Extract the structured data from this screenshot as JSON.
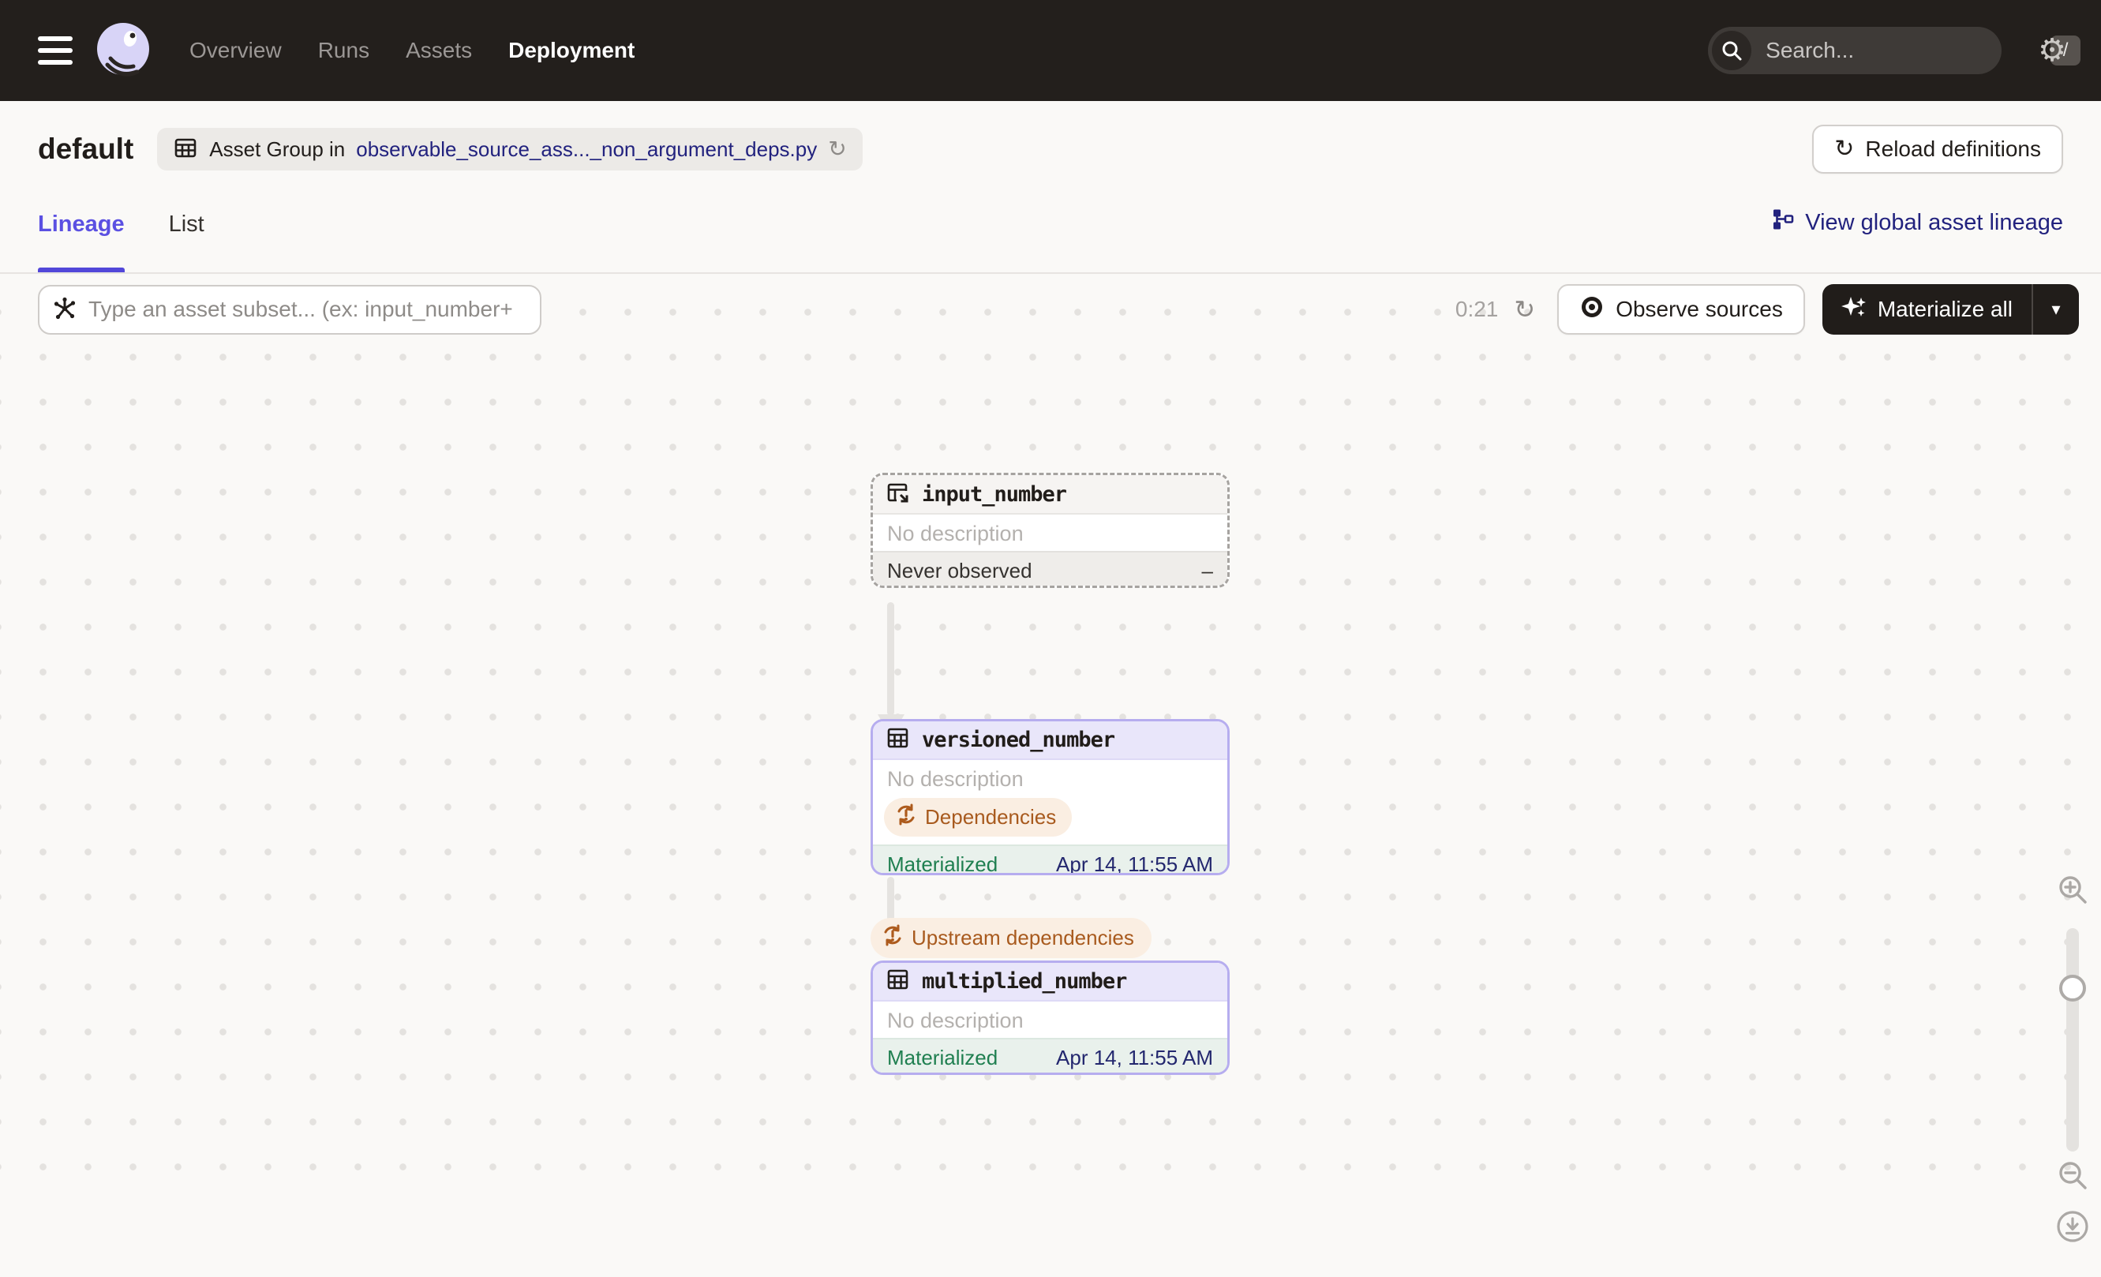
{
  "nav": {
    "items": [
      {
        "label": "Overview",
        "active": false
      },
      {
        "label": "Runs",
        "active": false
      },
      {
        "label": "Assets",
        "active": false
      },
      {
        "label": "Deployment",
        "active": true
      }
    ],
    "search": {
      "placeholder": "Search...",
      "shortcut": "/"
    }
  },
  "header": {
    "title": "default",
    "group_badge_prefix": "Asset Group in",
    "group_badge_link": "observable_source_ass..._non_argument_deps.py",
    "reload_button": "Reload definitions"
  },
  "tabs": {
    "items": [
      {
        "label": "Lineage",
        "active": true
      },
      {
        "label": "List",
        "active": false
      }
    ],
    "global_lineage_link": "View global asset lineage"
  },
  "toolbar": {
    "filter_placeholder": "Type an asset subset... (ex: input_number+",
    "timer": "0:21",
    "observe_button": "Observe sources",
    "materialize_button": "Materialize all"
  },
  "graph": {
    "nodes": [
      {
        "name": "input_number",
        "description": "No description",
        "status_label": "Never observed",
        "status_value": "–",
        "kind": "observable-source"
      },
      {
        "name": "versioned_number",
        "description": "No description",
        "badge": "Dependencies",
        "status_label": "Materialized",
        "status_value": "Apr 14, 11:55 AM",
        "kind": "asset"
      },
      {
        "name": "multiplied_number",
        "description": "No description",
        "status_label": "Materialized",
        "status_value": "Apr 14, 11:55 AM",
        "kind": "asset"
      }
    ],
    "edge_badge": "Upstream dependencies"
  },
  "icons": {
    "menu": "hamburger-icon",
    "logo": "dagster-octopus-logo",
    "search": "search-icon",
    "settings": "gear-icon",
    "asset_group": "table-icon",
    "reload": "refresh-icon",
    "lineage_graph": "org-chart-icon",
    "op_selector": "asterisk-node-icon",
    "observe": "eye-icon",
    "materialize": "sparkle-icon",
    "dependencies": "sync-alert-icon",
    "zoom_in": "zoom-in-icon",
    "zoom_out": "zoom-out-icon",
    "download": "download-icon"
  },
  "colors": {
    "nav_bg": "#231F1C",
    "page_bg": "#FAF9F7",
    "accent_tab": "#5B50E2",
    "link_navy": "#22227E",
    "node_border_purple": "#B6ADEF",
    "node_header_purple": "#E9E6FA",
    "materialized_green": "#1F7F50",
    "timestamp_navy": "#23276E",
    "warning_orange": "#A85A1E",
    "warning_bg": "#FAEEE2",
    "footer_gray": "#EFEDEA",
    "footer_green": "#E9F1EC",
    "dot_grid": "#E4E2DF"
  }
}
